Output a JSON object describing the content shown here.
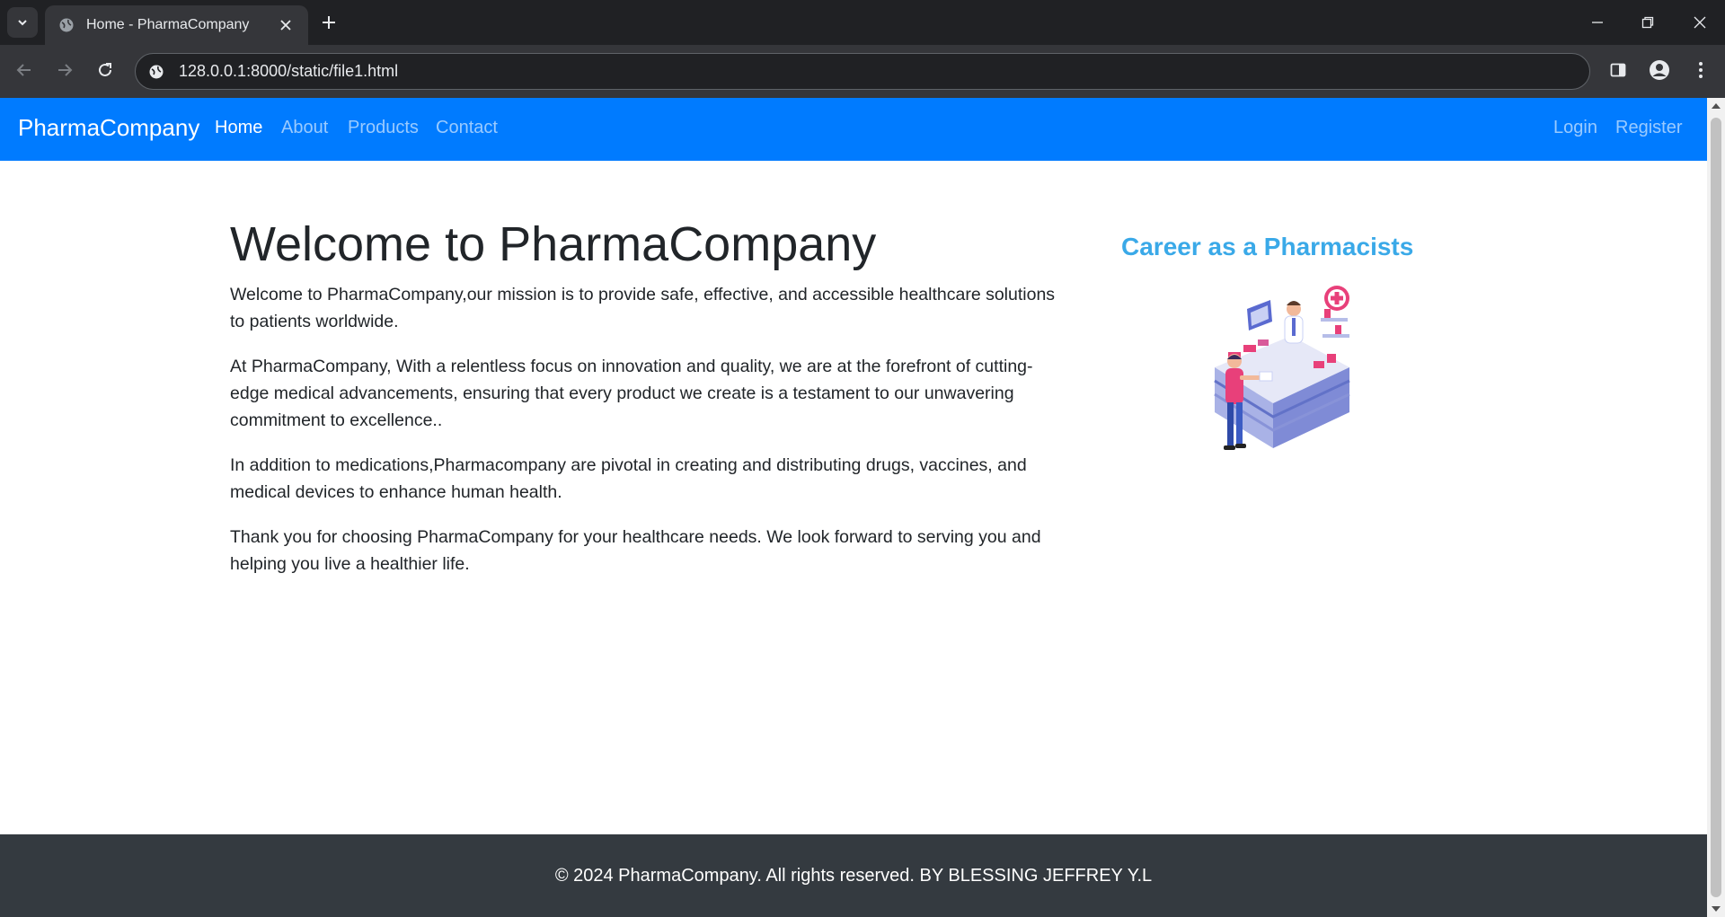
{
  "browser": {
    "tab_title": "Home - PharmaCompany",
    "url": "128.0.0.1:8000/static/file1.html"
  },
  "navbar": {
    "brand": "PharmaCompany",
    "links": [
      "Home",
      "About",
      "Products",
      "Contact"
    ],
    "active_link": "Home",
    "right_links": [
      "Login",
      "Register"
    ],
    "color": "#007bff"
  },
  "main": {
    "title": "Welcome to PharmaCompany",
    "paragraphs": [
      "Welcome to PharmaCompany,our mission is to provide safe, effective, and accessible healthcare solutions to patients worldwide.",
      "At PharmaCompany, With a relentless focus on innovation and quality, we are at the forefront of cutting-edge medical advancements, ensuring that every product we create is a testament to our unwavering commitment to excellence..",
      "In addition to medications,Pharmacompany are pivotal in creating and distributing drugs, vaccines, and medical devices to enhance human health.",
      "Thank you for choosing PharmaCompany for your healthcare needs. We look forward to serving you and helping you live a healthier life."
    ]
  },
  "promo": {
    "title": "Career as a Pharmacists",
    "title_color": "#3aa9e8",
    "image": "pharmacy-counter-illustration"
  },
  "footer": {
    "text": "© 2024 PharmaCompany. All rights reserved. BY BLESSING JEFFREY Y.L",
    "color": "#343a40"
  }
}
